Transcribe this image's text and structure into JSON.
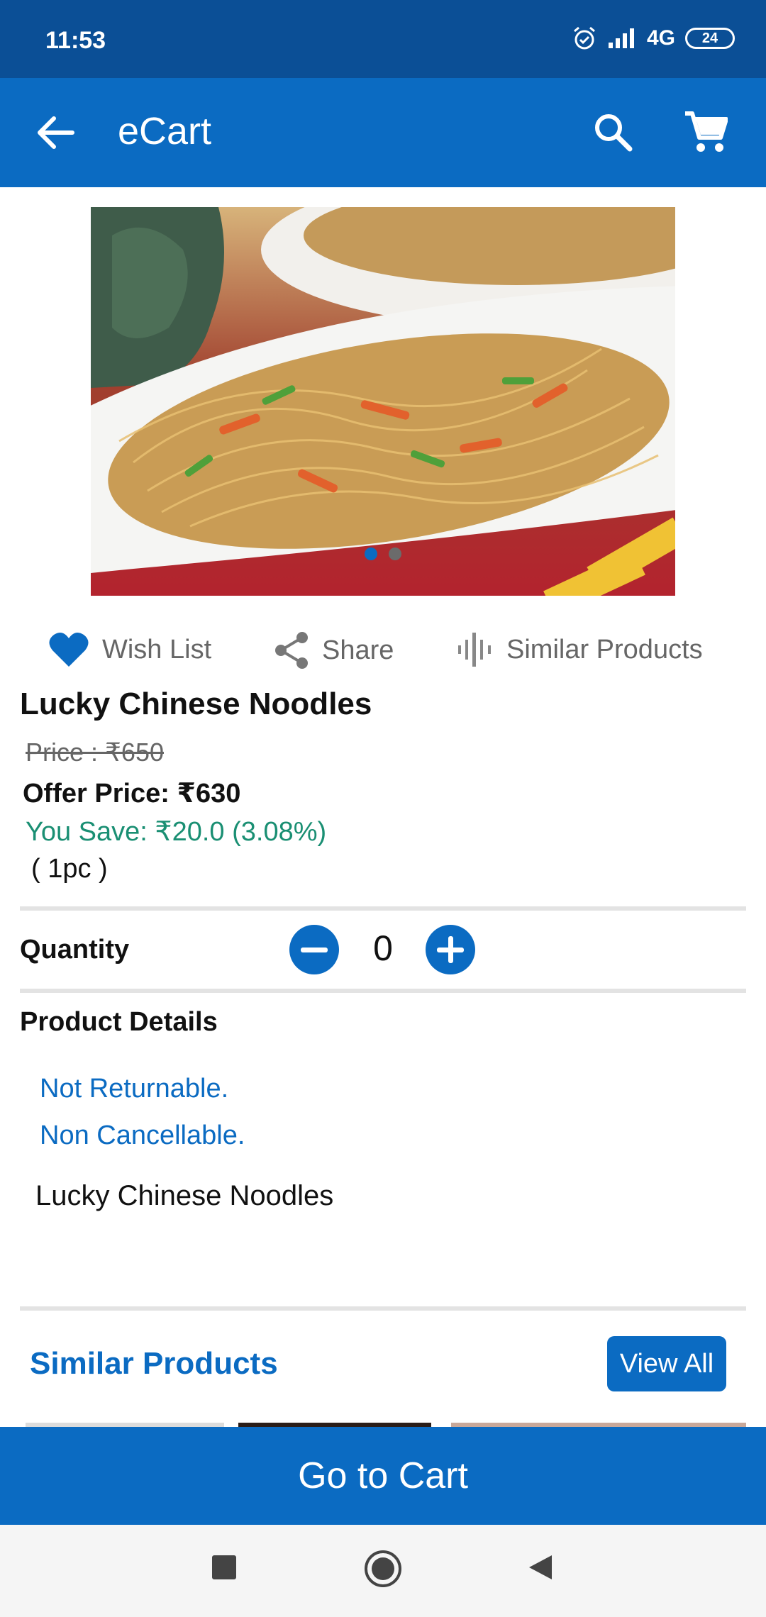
{
  "status_bar": {
    "time": "11:53",
    "network": "4G",
    "battery": "24"
  },
  "app_bar": {
    "title": "eCart"
  },
  "icons": {
    "back": "arrow-left-icon",
    "search": "search-icon",
    "cart": "cart-icon",
    "wishlist": "heart-icon",
    "share": "share-icon",
    "similar": "similar-products-icon"
  },
  "carousel": {
    "active_index": 0,
    "count": 2
  },
  "actions": {
    "wishlist_label": "Wish List",
    "share_label": "Share",
    "similar_label": "Similar Products"
  },
  "product": {
    "name": "Lucky Chinese Noodles",
    "price_label": "Price : ₹650",
    "offer_price_label": "Offer Price: ₹630",
    "you_save_label": "You Save: ₹20.0 (3.08%)",
    "unit": "( 1pc )"
  },
  "quantity": {
    "label": "Quantity",
    "value": "0"
  },
  "details": {
    "title": "Product Details",
    "returnable": "Not Returnable.",
    "cancellable": "Non Cancellable.",
    "description": "Lucky Chinese Noodles"
  },
  "similar": {
    "title": "Similar Products",
    "view_all_label": "View All"
  },
  "footer": {
    "go_to_cart_label": "Go to Cart"
  },
  "colors": {
    "primary": "#0b6bc2",
    "status_bar": "#0b4f96",
    "save_green": "#1a8f73"
  }
}
